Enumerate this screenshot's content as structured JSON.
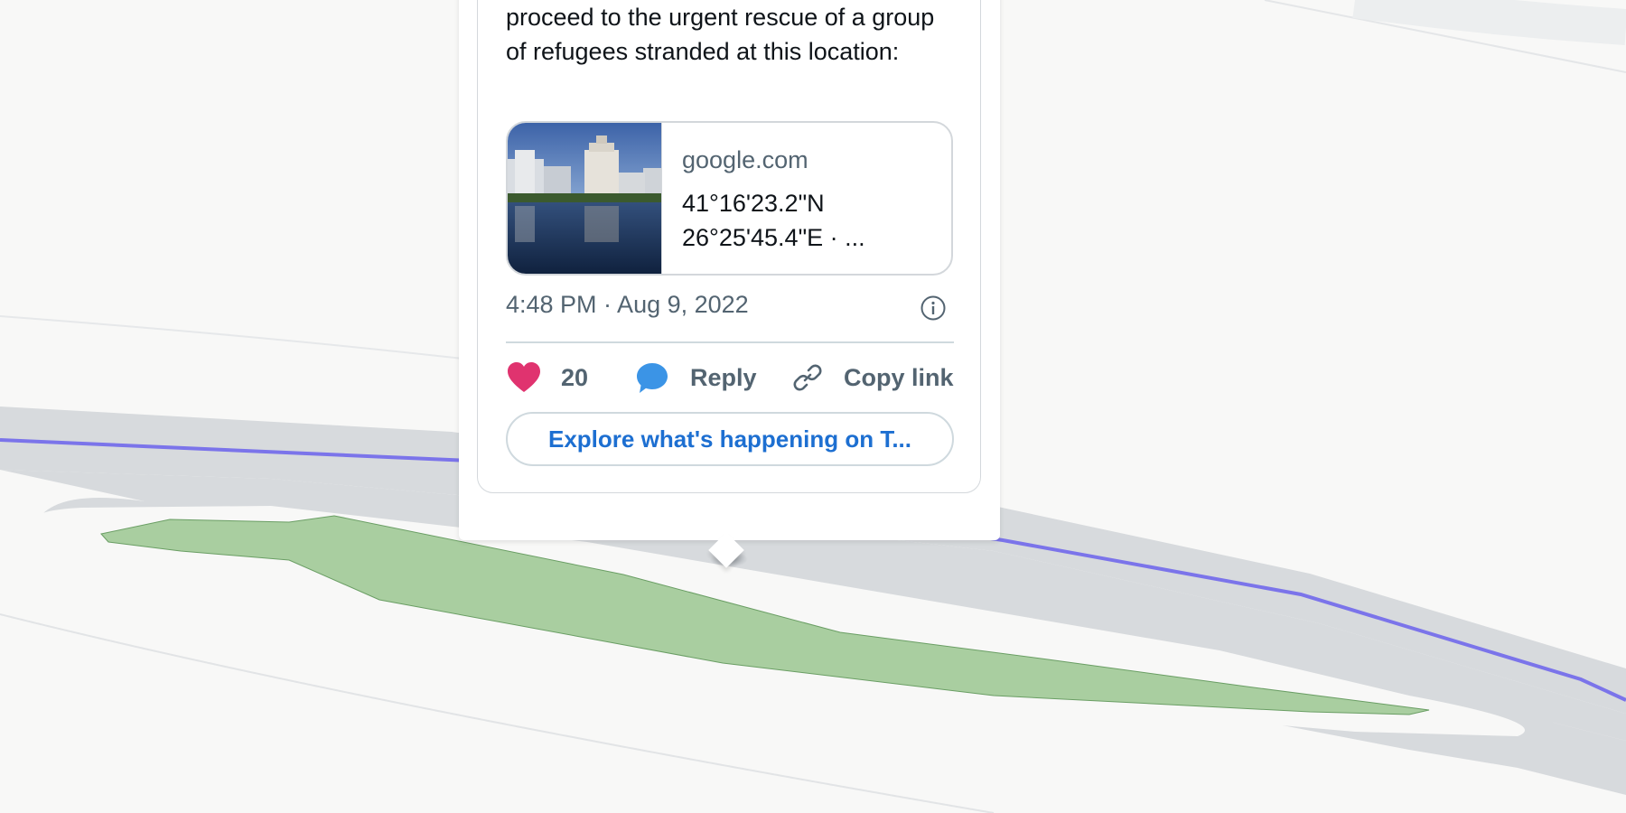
{
  "tweet": {
    "text": "proceed to the urgent rescue of a group of refugees stranded at this location:",
    "link_card": {
      "domain": "google.com",
      "title": "41°16'23.2\"N 26°25'45.4\"E · ..."
    },
    "timestamp": "4:48 PM · Aug 9, 2022",
    "actions": {
      "like_count": "20",
      "reply_label": "Reply",
      "copy_link_label": "Copy link"
    },
    "explore_label": "Explore what's happening on T..."
  },
  "colors": {
    "map_background": "#f8f8f7",
    "road": "#d7dadd",
    "route_line": "#7b74ea",
    "island_fill": "#a9cea0",
    "like_heart": "#e0336f",
    "reply_bubble": "#3b94e6",
    "link_blue": "#1d6fd1",
    "secondary_text": "#536471"
  },
  "icons": [
    "heart-icon",
    "reply-bubble-icon",
    "link-icon",
    "info-icon"
  ]
}
